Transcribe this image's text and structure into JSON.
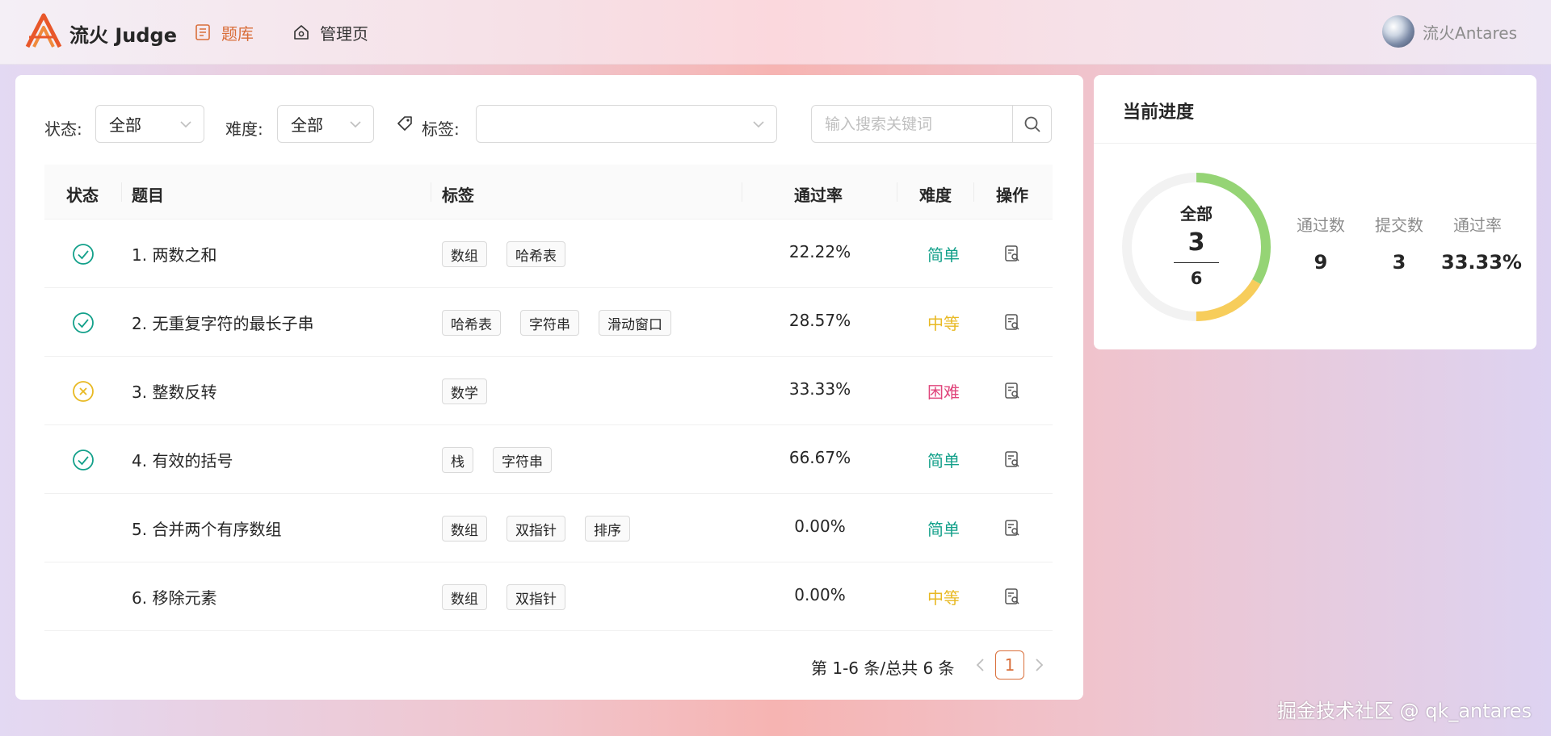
{
  "header": {
    "brand": "流火 Judge",
    "nav": [
      {
        "label": "题库",
        "icon": "list-icon",
        "active": true
      },
      {
        "label": "管理页",
        "icon": "home-gear-icon",
        "active": false
      }
    ],
    "user": {
      "name": "流火Antares"
    }
  },
  "filters": {
    "status_label": "状态:",
    "status_value": "全部",
    "difficulty_label": "难度:",
    "difficulty_value": "全部",
    "tags_label": "标签:",
    "tags_value": "",
    "search_placeholder": "输入搜索关键词"
  },
  "table": {
    "columns": [
      "状态",
      "题目",
      "标签",
      "通过率",
      "难度",
      "操作"
    ],
    "rows": [
      {
        "status": "passed",
        "title": "1. 两数之和",
        "tags": [
          "数组",
          "哈希表"
        ],
        "rate": "22.22%",
        "difficulty": "简单",
        "difficulty_color": "#13a08a"
      },
      {
        "status": "passed",
        "title": "2. 无重复字符的最长子串",
        "tags": [
          "哈希表",
          "字符串",
          "滑动窗口"
        ],
        "rate": "28.57%",
        "difficulty": "中等",
        "difficulty_color": "#e8b923"
      },
      {
        "status": "failed",
        "title": "3. 整数反转",
        "tags": [
          "数学"
        ],
        "rate": "33.33%",
        "difficulty": "困难",
        "difficulty_color": "#e0457b"
      },
      {
        "status": "passed",
        "title": "4. 有效的括号",
        "tags": [
          "栈",
          "字符串"
        ],
        "rate": "66.67%",
        "difficulty": "简单",
        "difficulty_color": "#13a08a"
      },
      {
        "status": "none",
        "title": "5. 合并两个有序数组",
        "tags": [
          "数组",
          "双指针",
          "排序"
        ],
        "rate": "0.00%",
        "difficulty": "简单",
        "difficulty_color": "#13a08a"
      },
      {
        "status": "none",
        "title": "6. 移除元素",
        "tags": [
          "数组",
          "双指针"
        ],
        "rate": "0.00%",
        "difficulty": "中等",
        "difficulty_color": "#e8b923"
      }
    ]
  },
  "pagination": {
    "summary": "第 1-6 条/总共 6 条",
    "current_page": "1"
  },
  "progress": {
    "title": "当前进度",
    "ring_label": "全部",
    "ring_value": "3",
    "ring_total": "6",
    "ring_segments": {
      "pass_fraction": 0.667,
      "fail_fraction": 0.333,
      "pass_color": "#95d475",
      "fail_color": "#f7cd5b"
    },
    "stats": [
      {
        "label": "通过数",
        "value": "9"
      },
      {
        "label": "提交数",
        "value": "3"
      },
      {
        "label": "通过率",
        "value": "33.33%"
      }
    ]
  },
  "watermark": "掘金技术社区 @ qk_antares",
  "colors": {
    "accent": "#d96f3b",
    "passed": "#13a08a",
    "failed": "#e8b923"
  }
}
